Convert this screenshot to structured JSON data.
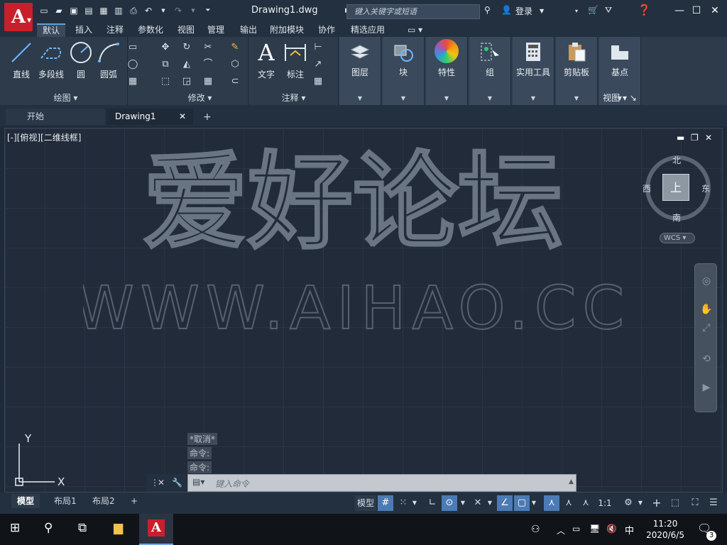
{
  "window": {
    "title": "Drawing1.dwg",
    "search_placeholder": "键入关键字或短语",
    "login": "登录",
    "app_letter": "A"
  },
  "tabs": [
    "默认",
    "插入",
    "注释",
    "参数化",
    "视图",
    "管理",
    "输出",
    "附加模块",
    "协作",
    "精选应用"
  ],
  "ribbon": {
    "draw_tools": {
      "line": "直线",
      "polyline": "多段线",
      "circle": "圆",
      "arc": "圆弧"
    },
    "panels": {
      "draw": "绘图",
      "modify": "修改",
      "annotation": "注释",
      "view": "视图"
    },
    "annotation_tools": {
      "text": "文字",
      "dimension": "标注"
    },
    "big_buttons": [
      "图层",
      "块",
      "特性",
      "组",
      "实用工具",
      "剪贴板",
      "基点"
    ]
  },
  "doc_tabs": {
    "start": "开始",
    "drawing": "Drawing1",
    "close": "✕",
    "add": "+"
  },
  "viewport": {
    "label": "[-][俯视][二维线框]",
    "watermark_line1": "爱好论坛",
    "watermark_line2": "WWW.AIHAO.CC",
    "viewcube": {
      "north": "北",
      "south": "南",
      "east": "东",
      "west": "西",
      "face": "上",
      "wcs": "WCS"
    },
    "ucs": {
      "x": "X",
      "y": "Y"
    }
  },
  "command": {
    "history": [
      "*取消*",
      "命令:",
      "命令:"
    ],
    "placeholder": "键入命令"
  },
  "layouts": [
    "模型",
    "布局1",
    "布局2"
  ],
  "status": {
    "model": "模型",
    "scale": "1:1"
  },
  "taskbar": {
    "ime": "中",
    "time": "11:20",
    "date": "2020/6/5",
    "notif": "3"
  },
  "colors": {
    "accent": "#4b7bb5",
    "brand": "#c8202a",
    "ribbon": "#2d3b4b"
  }
}
